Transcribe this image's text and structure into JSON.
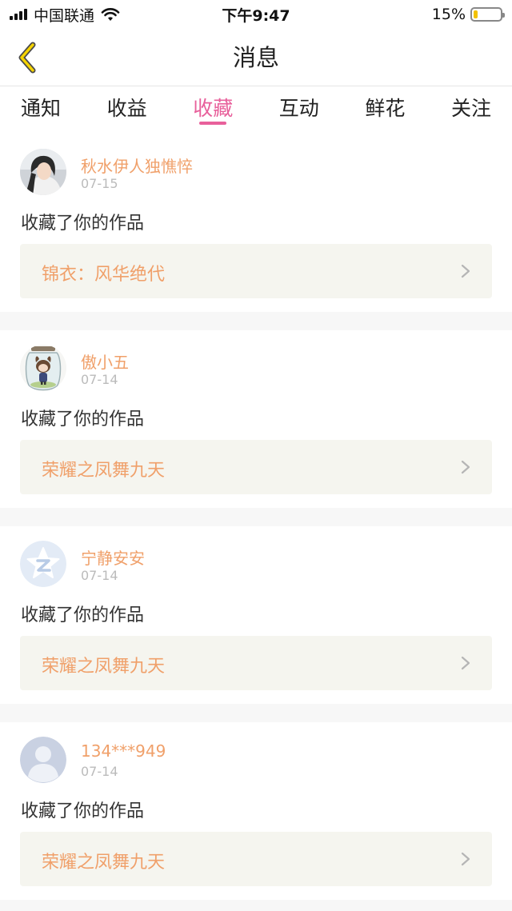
{
  "status_bar": {
    "carrier": "中国联通",
    "time": "下午9:47",
    "battery": "15%",
    "battery_level": 0.15
  },
  "header": {
    "title": "消息",
    "back_icon": "chevron-left-icon"
  },
  "tabs": [
    {
      "label": "通知",
      "active": false
    },
    {
      "label": "收益",
      "active": false
    },
    {
      "label": "收藏",
      "active": true
    },
    {
      "label": "互动",
      "active": false
    },
    {
      "label": "鲜花",
      "active": false
    },
    {
      "label": "关注",
      "active": false
    }
  ],
  "colors": {
    "accent": "#e8609b",
    "name": "#f0a06a",
    "work_bg": "#f5f5ef"
  },
  "messages": [
    {
      "username": "秋水伊人独憔悴",
      "date": "07-15",
      "action": "收藏了你的作品",
      "work": "锦衣：风华绝代"
    },
    {
      "username": "傲小五",
      "date": "07-14",
      "action": "收藏了你的作品",
      "work": "荣耀之凤舞九天"
    },
    {
      "username": "宁静安安",
      "date": "07-14",
      "action": "收藏了你的作品",
      "work": "荣耀之凤舞九天"
    },
    {
      "username": "134***949",
      "date": "07-14",
      "action": "收藏了你的作品",
      "work": "荣耀之凤舞九天"
    }
  ]
}
